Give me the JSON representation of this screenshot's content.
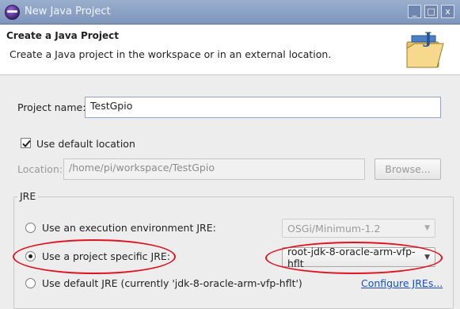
{
  "window": {
    "title": "New Java Project",
    "controls": [
      "_",
      "□",
      "x"
    ]
  },
  "header": {
    "title": "Create a Java Project",
    "description": "Create a Java project in the workspace or in an external location."
  },
  "project": {
    "name_label": "Project name:",
    "name_value": "TestGpio"
  },
  "location": {
    "use_default_label": "Use default location",
    "use_default_checked": true,
    "location_label": "Location:",
    "location_value": "/home/pi/workspace/TestGpio",
    "browse_label": "Browse..."
  },
  "jre": {
    "group_label": "JRE",
    "options": [
      {
        "label": "Use an execution environment JRE:",
        "selected": false,
        "combo_value": "OSGi/Minimum-1.2"
      },
      {
        "label": "Use a project specific JRE:",
        "selected": true,
        "combo_value": "root-jdk-8-oracle-arm-vfp-hflt"
      },
      {
        "label": "Use default JRE (currently 'jdk-8-oracle-arm-vfp-hflt')",
        "selected": false,
        "link": "Configure JREs..."
      }
    ]
  },
  "annotations": {
    "highlight_color": "#e0141e"
  }
}
